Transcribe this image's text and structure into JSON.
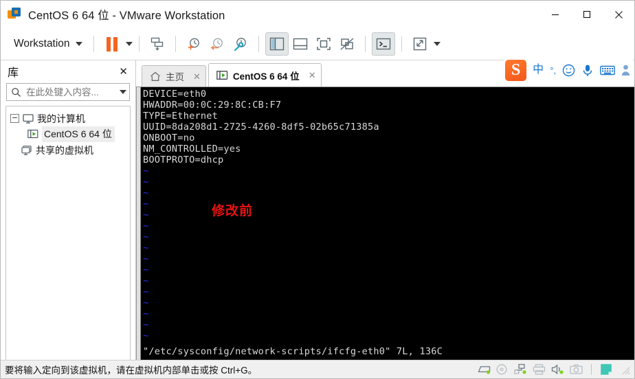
{
  "window": {
    "title": "CentOS 6 64 位 - VMware Workstation",
    "app_icon": "vmware-logo-icon",
    "controls": {
      "minimize": "minimize-icon",
      "maximize": "maximize-icon",
      "close": "close-icon"
    }
  },
  "toolbar": {
    "workstation_menu": "Workstation",
    "buttons": [
      {
        "name": "pause-vm-button",
        "icon": "pause-icon"
      },
      {
        "name": "power-dropdown-button",
        "icon": "chevron-down-icon"
      },
      {
        "name": "manage-vm-button",
        "icon": "vm-settings-icon"
      },
      {
        "name": "take-snapshot-button",
        "icon": "snapshot-add-icon"
      },
      {
        "name": "revert-snapshot-button",
        "icon": "snapshot-revert-icon"
      },
      {
        "name": "snapshot-manager-button",
        "icon": "snapshot-manager-icon"
      },
      {
        "name": "show-library-button",
        "icon": "panel-left-icon"
      },
      {
        "name": "show-thumbnail-bar-button",
        "icon": "panel-bottom-icon"
      },
      {
        "name": "fullscreen-button",
        "icon": "fullscreen-icon"
      },
      {
        "name": "unity-mode-button",
        "icon": "unity-icon"
      },
      {
        "name": "console-view-button",
        "icon": "terminal-icon"
      },
      {
        "name": "stretch-view-button",
        "icon": "expand-arrows-icon"
      },
      {
        "name": "stretch-dropdown-button",
        "icon": "chevron-down-icon"
      }
    ]
  },
  "library": {
    "title": "库",
    "close_label": "✕",
    "search": {
      "placeholder": "在此处键入内容...",
      "value": "",
      "icon": "search-icon",
      "dropdown_icon": "chevron-down-icon"
    },
    "tree": [
      {
        "label": "我的计算机",
        "icon": "computer-icon",
        "level": 0,
        "expanded": true,
        "selected": false
      },
      {
        "label": "CentOS 6 64 位",
        "icon": "vm-running-icon",
        "level": 1,
        "expanded": false,
        "selected": true
      },
      {
        "label": "共享的虚拟机",
        "icon": "shared-vm-icon",
        "level": 0,
        "expanded": false,
        "selected": false
      }
    ]
  },
  "tabs": [
    {
      "label": "主页",
      "icon": "home-icon",
      "active": false,
      "close_label": "✕"
    },
    {
      "label": "CentOS 6 64 位",
      "icon": "vm-running-icon",
      "active": true,
      "close_label": "✕"
    }
  ],
  "ime": {
    "logo": "S",
    "items": [
      {
        "name": "ime-mode-chinese",
        "glyph": "中"
      },
      {
        "name": "ime-punctuation-toggle",
        "glyph": "°,"
      },
      {
        "name": "ime-emoji-button",
        "glyph": "☺"
      },
      {
        "name": "ime-voice-input-button",
        "glyph": "🎤"
      },
      {
        "name": "ime-soft-keyboard-button",
        "glyph": "⌨"
      },
      {
        "name": "ime-user-menu-button",
        "glyph": "👤"
      }
    ]
  },
  "terminal": {
    "lines": [
      "DEVICE=eth0",
      "HWADDR=00:0C:29:8C:CB:F7",
      "TYPE=Ethernet",
      "UUID=8da208d1-2725-4260-8df5-02b65c71385a",
      "ONBOOT=no",
      "NM_CONTROLLED=yes",
      "BOOTPROTO=dhcp"
    ],
    "empty_marker": "~",
    "empty_line_count": 16,
    "status_line": "\"/etc/sysconfig/network-scripts/ifcfg-eth0\" 7L, 136C",
    "annotation": "修改前",
    "colors": {
      "background": "#000000",
      "foreground": "#d8d8d8",
      "tilde": "#2b2bf5",
      "annotation": "#e81313"
    }
  },
  "statusbar": {
    "message": "要将输入定向到该虚拟机，请在虚拟机内部单击或按 Ctrl+G。",
    "icons": [
      {
        "name": "hard-disk-status-icon",
        "glyph": "disk"
      },
      {
        "name": "cd-dvd-status-icon",
        "glyph": "cd"
      },
      {
        "name": "network-adapter-status-icon",
        "glyph": "network"
      },
      {
        "name": "printer-status-icon",
        "glyph": "printer"
      },
      {
        "name": "sound-card-status-icon",
        "glyph": "sound"
      },
      {
        "name": "camera-status-icon",
        "glyph": "camera"
      },
      {
        "name": "message-log-status-icon",
        "glyph": "note"
      }
    ]
  },
  "colors": {
    "accent_orange": "#f26522",
    "ime_blue": "#1877cf",
    "toolbar_icon": "#5b6a72"
  }
}
